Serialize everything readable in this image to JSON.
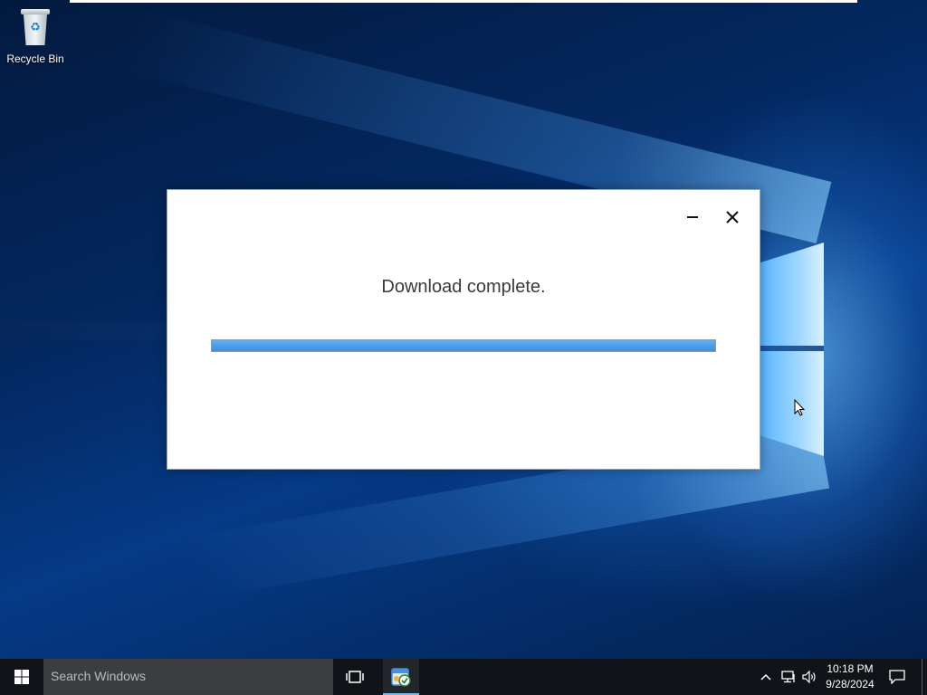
{
  "desktop": {
    "icons": [
      {
        "label": "Recycle Bin",
        "icon": "recycle-bin-icon"
      }
    ]
  },
  "dialog": {
    "message": "Download complete.",
    "progress_percent": 100,
    "controls": {
      "minimize": "minimize-icon",
      "close": "close-icon"
    }
  },
  "taskbar": {
    "start_icon": "windows-start-icon",
    "search_placeholder": "Search Windows",
    "task_view_icon": "task-view-icon",
    "pinned_app_icon": "installer-app-icon",
    "tray": {
      "show_hidden_icon": "chevron-up-icon",
      "network_icon": "network-icon",
      "volume_icon": "volume-icon",
      "notifications_icon": "action-center-icon"
    },
    "clock": {
      "time": "10:18 PM",
      "date": "9/28/2024"
    }
  },
  "colors": {
    "progress_fill": "#3d8fe0",
    "taskbar_bg": "#101317",
    "search_bg": "#3b3d41",
    "desktop_accent": "#053a86"
  }
}
